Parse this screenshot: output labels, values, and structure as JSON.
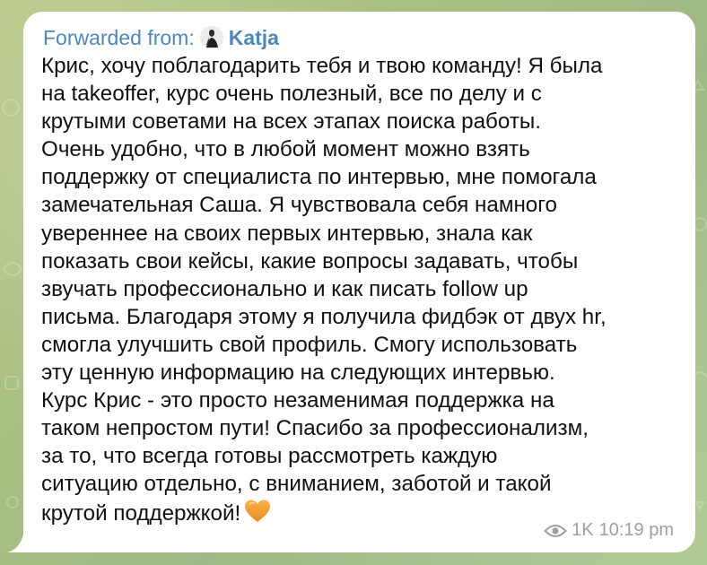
{
  "message": {
    "forwarded_prefix": "Forwarded from:",
    "forwarded_name": "Katja",
    "text_lines": [
      "Крис, хочу поблагодарить тебя и твою команду! Я была",
      "на takeoffer, курс очень полезный, все по делу и с",
      "крутыми советами на всех этапах поиска работы.",
      "Очень удобно, что в любой момент можно взять",
      "поддержку от специалиста по интервью, мне помогала",
      "замечательная Саша. Я чувствовала себя намного",
      "увереннее на своих первых интервью, знала как",
      "показать свои кейсы, какие вопросы задавать, чтобы",
      "звучать профессионально и как писать follow up",
      "письма. Благодаря этому я получила фидбэк от двух hr,",
      "смогла улучшить свой профиль. Смогу использовать",
      "эту ценную информацию на следующих интервью.",
      "Курс Крис - это просто незаменимая поддержка на",
      "таком непростом пути! Спасибо за профессионализм,",
      "за то, что всегда готовы рассмотреть каждую",
      "ситуацию отдельно, с вниманием, заботой и такой",
      "крутой поддержкой!"
    ],
    "emoji": "orange-heart",
    "views": "1K",
    "time": "10:19 pm"
  },
  "colors": {
    "link_blue": "#4f87b8",
    "text": "#111111",
    "meta_gray": "#9aa0a6",
    "heart_orange": "#f29a2e",
    "bubble_bg": "#ffffff"
  }
}
